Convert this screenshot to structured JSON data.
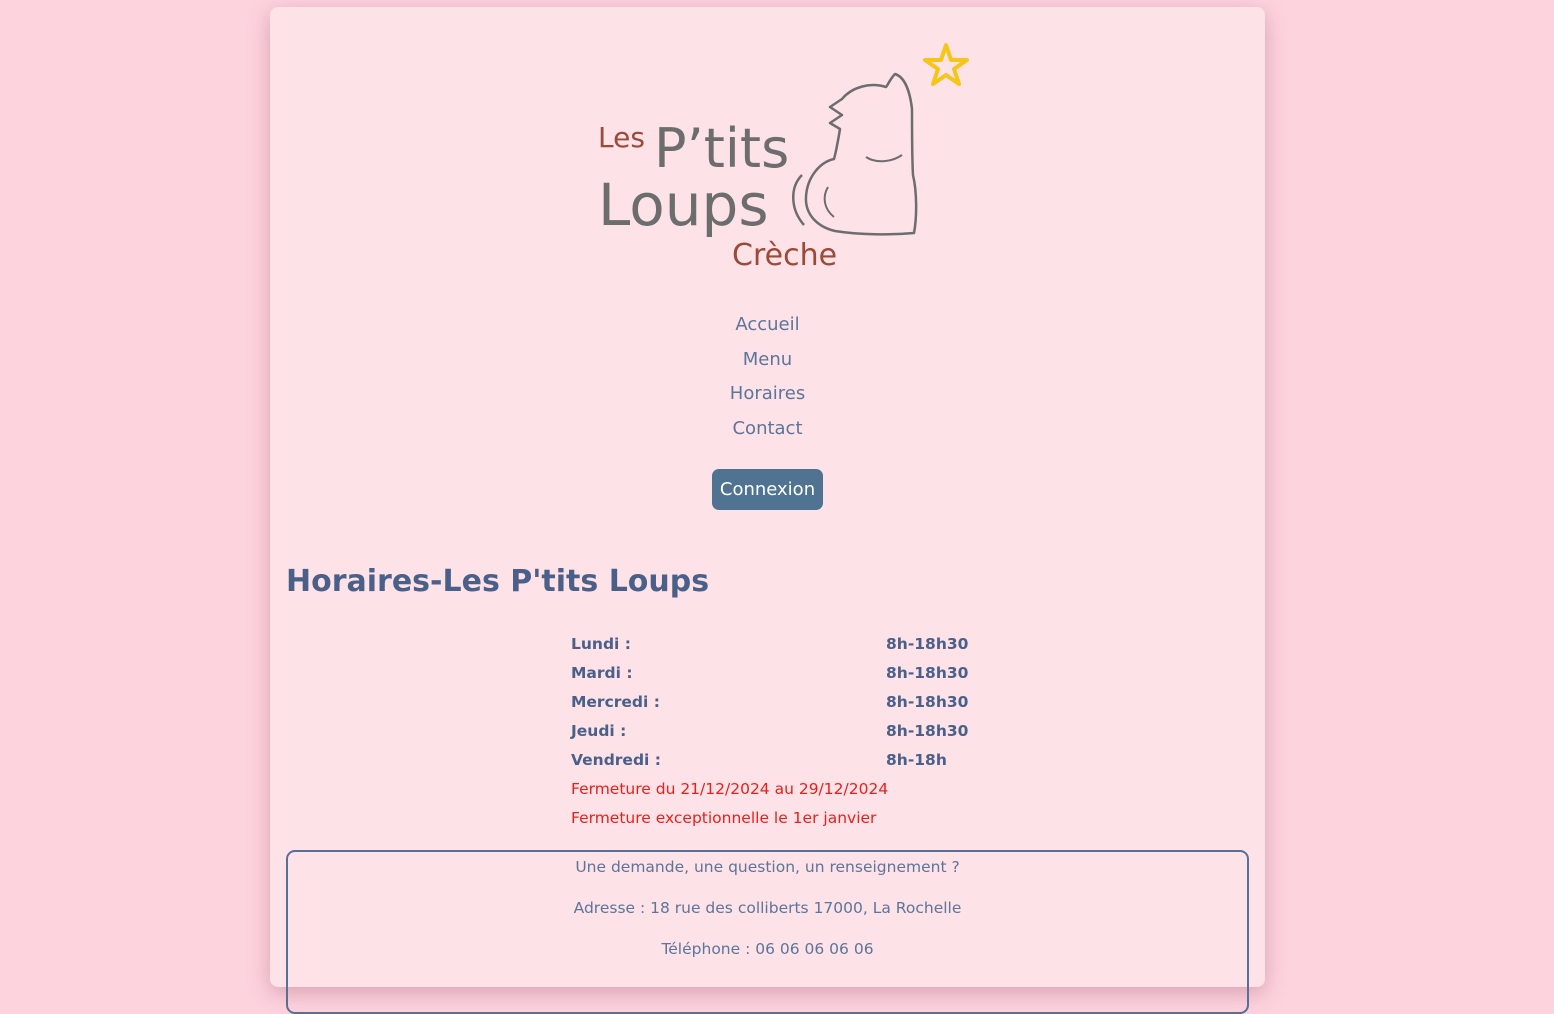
{
  "logo": {
    "line1": "Les",
    "line2": "P’tits",
    "line3": "Loups",
    "line4": "Crèche",
    "star_color": "#f5c518",
    "text_color_gray": "#6d6d6d",
    "text_color_brown": "#9a4a36"
  },
  "nav": {
    "items": [
      {
        "label": "Accueil"
      },
      {
        "label": "Menu"
      },
      {
        "label": "Horaires"
      },
      {
        "label": "Contact"
      }
    ]
  },
  "login": {
    "label": "Connexion"
  },
  "page": {
    "title": "Horaires-Les P'tits Loups"
  },
  "schedule": {
    "rows": [
      {
        "day": "Lundi :",
        "hours": "8h-18h30"
      },
      {
        "day": "Mardi :",
        "hours": "8h-18h30"
      },
      {
        "day": "Mercredi :",
        "hours": "8h-18h30"
      },
      {
        "day": "Jeudi :",
        "hours": "8h-18h30"
      },
      {
        "day": "Vendredi :",
        "hours": "8h-18h"
      }
    ],
    "closures": [
      "Fermeture du 21/12/2024 au 29/12/2024",
      "Fermeture exceptionnelle le 1er janvier"
    ]
  },
  "contact": {
    "question": "Une demande, une question, un renseignement ?",
    "address": "Adresse : 18 rue des colliberts 17000, La Rochelle",
    "phone": "Téléphone : 06 06 06 06 06"
  },
  "colors": {
    "page_bg": "#fdd3de",
    "card_bg": "#fde2e8",
    "accent": "#4b6089",
    "button": "#4f7390",
    "alert": "#e8201b"
  }
}
